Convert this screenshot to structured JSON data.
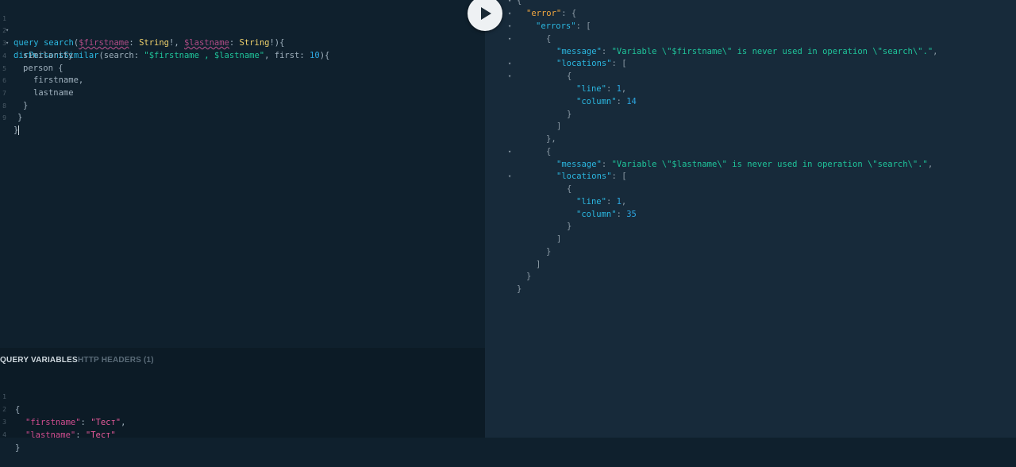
{
  "query_editor": {
    "lines": [
      {
        "n": "1",
        "fold": true
      },
      {
        "n": "2",
        "fold": true
      },
      {
        "n": "3"
      },
      {
        "n": "4"
      },
      {
        "n": "5"
      },
      {
        "n": "6"
      },
      {
        "n": "7"
      },
      {
        "n": "8"
      },
      {
        "n": "9"
      }
    ],
    "tokens": {
      "l1_query": "query",
      "l1_name": "search",
      "l1_open": "(",
      "l1_var1": "$firstname",
      "l1_colon1": ": ",
      "l1_type1": "String",
      "l1_bang1": "!, ",
      "l1_var2": "$lastname",
      "l1_colon2": ": ",
      "l1_type2": "String",
      "l1_close": "!){",
      "l2_field": "dirPersonsSimilar",
      "l2_open": "(",
      "l2_arg1": "search",
      "l2_c1": ": ",
      "l2_str": "\"$firstname , $lastname\"",
      "l2_comma": ", ",
      "l2_arg2": "first",
      "l2_c2": ": ",
      "l2_num": "10",
      "l2_close": "){",
      "l3": "similarity",
      "l4": "person {",
      "l5": "firstname,",
      "l6": "lastname",
      "l7": "}",
      "l8": "}",
      "l9": "}"
    }
  },
  "variables_panel": {
    "tab_variables": "QUERY VARIABLES",
    "tab_headers": "HTTP HEADERS (1)",
    "lines": [
      {
        "n": "1",
        "text": "{"
      },
      {
        "n": "2",
        "key": "\"firstname\"",
        "sep": ": ",
        "val": "\"Тест\"",
        "tail": ","
      },
      {
        "n": "3",
        "key": "\"lastname\"",
        "sep": ": ",
        "val": "\"Тест\"",
        "tail": ""
      },
      {
        "n": "4",
        "text": "}"
      }
    ]
  },
  "run_button": {
    "icon": "play-icon"
  },
  "result": {
    "t": {
      "r0": "{",
      "r1k": "\"error\"",
      "r1p": ": {",
      "r2k": "\"errors\"",
      "r2p": ": [",
      "r3": "{",
      "r4k": "\"message\"",
      "r4s": ": ",
      "r4v": "\"Variable \\\"$firstname\\\" is never used in operation \\\"search\\\".\"",
      "r4t": ",",
      "r5k": "\"locations\"",
      "r5p": ": [",
      "r6": "{",
      "r7k": "\"line\"",
      "r7s": ": ",
      "r7v": "1",
      "r7t": ",",
      "r8k": "\"column\"",
      "r8s": ": ",
      "r8v": "14",
      "r9": "}",
      "r10": "]",
      "r11": "},",
      "r12": "{",
      "r13k": "\"message\"",
      "r13s": ": ",
      "r13v": "\"Variable \\\"$lastname\\\" is never used in operation \\\"search\\\".\"",
      "r13t": ",",
      "r14k": "\"locations\"",
      "r14p": ": [",
      "r15": "{",
      "r16k": "\"line\"",
      "r16s": ": ",
      "r16v": "1",
      "r16t": ",",
      "r17k": "\"column\"",
      "r17s": ": ",
      "r17v": "35",
      "r18": "}",
      "r19": "]",
      "r20": "}",
      "r21": "]",
      "r22": "}",
      "r23": "}"
    }
  },
  "colors": {
    "editor_bg": "#0f202d",
    "result_bg": "#172a3a",
    "keyword": "#2bb7e0",
    "string": "#1fc49a",
    "variable": "#b24c86",
    "type": "#f0d16b",
    "error_key": "#f0a640"
  }
}
